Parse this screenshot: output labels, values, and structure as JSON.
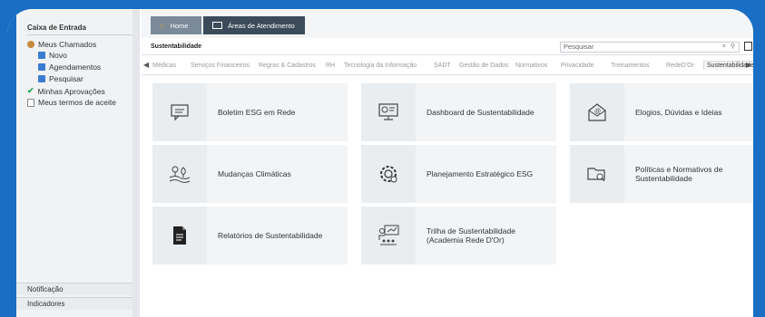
{
  "sidebar": {
    "inbox_title": "Caixa de Entrada",
    "items": [
      {
        "label": "Meus Chamados",
        "icon": "user-icon"
      },
      {
        "label": "Novo",
        "icon": "new-document-icon"
      },
      {
        "label": "Agendamentos",
        "icon": "calendar-icon"
      },
      {
        "label": "Pesquisar",
        "icon": "search-document-icon"
      },
      {
        "label": "Minhas Aprovações",
        "icon": "checkmark-icon"
      },
      {
        "label": "Meus termos de aceite",
        "icon": "document-icon"
      }
    ],
    "footer": [
      "Notificação",
      "Indicadores"
    ]
  },
  "topbar": {
    "home_label": "Home",
    "areas_label": "Áreas de Atendimento"
  },
  "title": "Sustentabilidade",
  "search": {
    "placeholder": "Pesquisar",
    "clear": "×"
  },
  "tabs": [
    "Médicas",
    "Serviços Financeiros",
    "Regras & Cadastros",
    "RH",
    "Tecnologia da Informação",
    "SADT",
    "Gestão de Dados",
    "Normativos",
    "Privacidade",
    "Treinamentos",
    "RedeD'Or",
    "Sustentabilidade"
  ],
  "tiles": [
    {
      "label": "Boletim ESG em Rede",
      "icon": "newsletter-icon"
    },
    {
      "label": "Dashboard de Sustentabilidade",
      "icon": "dashboard-monitor-icon"
    },
    {
      "label": "Elogios, Dúvidas e Ideias",
      "icon": "email-icon"
    },
    {
      "label": "Mudanças Climáticas",
      "icon": "climate-plants-icon"
    },
    {
      "label": "Planejamento Estratégico ESG",
      "icon": "strategy-gear-icon"
    },
    {
      "label": "Políticas e Normativos de Sustentabilidade",
      "icon": "folder-search-icon"
    },
    {
      "label": "Relatórios de Sustentabilidade",
      "icon": "report-document-icon"
    },
    {
      "label": "Trilha de Sustentabilidade (Academia Rede D'Or)",
      "icon": "training-presentation-icon"
    }
  ],
  "colors": {
    "background": "#1a6fc4",
    "home_button": "#7a8a99",
    "areas_button": "#3b4b59",
    "tile_bg": "#f2f4f6"
  }
}
